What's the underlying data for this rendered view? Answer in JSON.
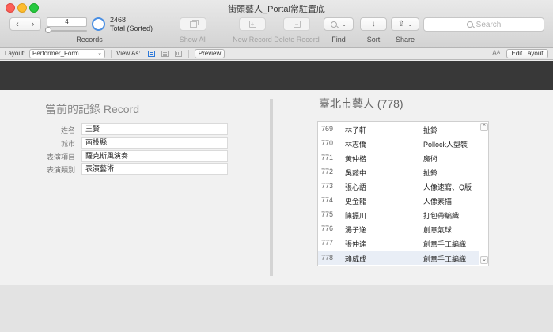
{
  "window": {
    "title": "街頭藝人_Portal常駐置底"
  },
  "toolbar": {
    "current_record": "4",
    "record_count": "2468",
    "record_status": "Total (Sorted)",
    "records_label": "Records",
    "show_all_label": "Show All",
    "new_record_label": "New Record",
    "delete_record_label": "Delete Record",
    "find_label": "Find",
    "sort_label": "Sort",
    "share_label": "Share",
    "search_placeholder": "Search"
  },
  "layout_bar": {
    "layout_label": "Layout:",
    "layout_value": "Performer_Form",
    "view_as_label": "View As:",
    "preview_label": "Preview",
    "aa_label": "Aᴬ",
    "edit_layout_label": "Edit Layout"
  },
  "current_record": {
    "title": "當前的記錄 Record",
    "fields": [
      {
        "label": "姓名",
        "value": "王賢"
      },
      {
        "label": "城市",
        "value": "南投縣"
      },
      {
        "label": "表演項目",
        "value": "薩克斯風演奏"
      },
      {
        "label": "表演類別",
        "value": "表演藝術"
      }
    ]
  },
  "portal": {
    "title": "臺北市藝人 (778)",
    "rows": [
      {
        "id": "769",
        "name": "林子軒",
        "category": "扯鈴"
      },
      {
        "id": "770",
        "name": "林志僑",
        "category": "Pollock人型裝"
      },
      {
        "id": "771",
        "name": "黃仲楷",
        "category": "魔術"
      },
      {
        "id": "772",
        "name": "吳懿中",
        "category": "扯鈴"
      },
      {
        "id": "773",
        "name": "張心語",
        "category": "人像速寫、Q版"
      },
      {
        "id": "774",
        "name": "史金龍",
        "category": "人像素描"
      },
      {
        "id": "775",
        "name": "陳振川",
        "category": "打包帶編織"
      },
      {
        "id": "776",
        "name": "湯子逸",
        "category": "創意氣球"
      },
      {
        "id": "777",
        "name": "張仲達",
        "category": "創意手工編織"
      },
      {
        "id": "778",
        "name": "賴威成",
        "category": "創意手工編織"
      }
    ],
    "selected_index": 9
  }
}
